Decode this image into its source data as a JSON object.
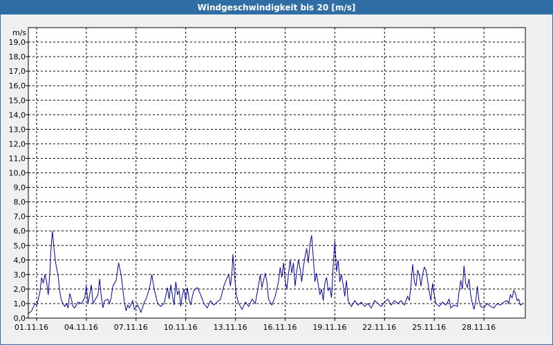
{
  "window": {
    "title": "Windgeschwindigkeit bis 20 [m/s]"
  },
  "colors": {
    "titlebar": "#2f6ea5",
    "line": "#0000a0",
    "grid": "#000000",
    "plot_bg": "#ffffff",
    "window_bg": "#f0f0f0"
  },
  "chart_data": {
    "type": "line",
    "title": "Windgeschwindigkeit bis 20 [m/s]",
    "ylabel": "m/s",
    "xlabel": "",
    "ylim": [
      0,
      20
    ],
    "xlim": [
      0,
      30
    ],
    "grid": true,
    "y_ticks": [
      "0,0",
      "1,0",
      "2,0",
      "3,0",
      "4,0",
      "5,0",
      "6,0",
      "7,0",
      "8,0",
      "9,0",
      "10,0",
      "11,0",
      "12,0",
      "13,0",
      "14,0",
      "15,0",
      "16,0",
      "17,0",
      "18,0",
      "19,0"
    ],
    "x_ticks": [
      {
        "day": 0,
        "label": "01.11.16"
      },
      {
        "day": 3,
        "label": "04.11.16"
      },
      {
        "day": 6,
        "label": "07.11.16"
      },
      {
        "day": 9,
        "label": "10.11.16"
      },
      {
        "day": 12,
        "label": "13.11.16"
      },
      {
        "day": 15,
        "label": "16.11.16"
      },
      {
        "day": 18,
        "label": "19.11.16"
      },
      {
        "day": 21,
        "label": "22.11.16"
      },
      {
        "day": 24,
        "label": "25.11.16"
      },
      {
        "day": 27,
        "label": "28.11.16"
      }
    ],
    "series": [
      {
        "points": [
          [
            0.0,
            0.3
          ],
          [
            0.2,
            0.5
          ],
          [
            0.4,
            1.0
          ],
          [
            0.5,
            0.9
          ],
          [
            0.6,
            1.3
          ],
          [
            0.7,
            1.8
          ],
          [
            0.8,
            2.8
          ],
          [
            0.9,
            2.4
          ],
          [
            1.0,
            3.0
          ],
          [
            1.1,
            2.5
          ],
          [
            1.2,
            1.6
          ],
          [
            1.3,
            3.2
          ],
          [
            1.35,
            4.5
          ],
          [
            1.45,
            6.0
          ],
          [
            1.55,
            4.8
          ],
          [
            1.65,
            3.8
          ],
          [
            1.8,
            2.9
          ],
          [
            1.9,
            1.8
          ],
          [
            2.0,
            1.2
          ],
          [
            2.2,
            0.8
          ],
          [
            2.3,
            1.0
          ],
          [
            2.4,
            0.7
          ],
          [
            2.5,
            1.7
          ],
          [
            2.6,
            1.3
          ],
          [
            2.7,
            0.8
          ],
          [
            2.8,
            0.7
          ],
          [
            3.0,
            1.1
          ],
          [
            3.2,
            1.0
          ],
          [
            3.4,
            1.4
          ],
          [
            3.5,
            2.2
          ],
          [
            3.6,
            1.0
          ],
          [
            3.7,
            1.6
          ],
          [
            3.8,
            2.3
          ],
          [
            3.9,
            1.0
          ],
          [
            4.0,
            1.2
          ],
          [
            4.2,
            1.6
          ],
          [
            4.3,
            2.7
          ],
          [
            4.4,
            1.5
          ],
          [
            4.5,
            0.7
          ],
          [
            4.6,
            1.2
          ],
          [
            4.8,
            1.3
          ],
          [
            4.9,
            1.0
          ],
          [
            5.0,
            1.4
          ],
          [
            5.1,
            2.2
          ],
          [
            5.3,
            2.6
          ],
          [
            5.45,
            3.8
          ],
          [
            5.6,
            3.0
          ],
          [
            5.7,
            2.0
          ],
          [
            5.8,
            1.1
          ],
          [
            5.9,
            0.5
          ],
          [
            6.0,
            0.9
          ],
          [
            6.1,
            0.7
          ],
          [
            6.3,
            1.2
          ],
          [
            6.4,
            0.6
          ],
          [
            6.6,
            0.9
          ],
          [
            6.8,
            0.4
          ],
          [
            7.0,
            1.1
          ],
          [
            7.1,
            1.3
          ],
          [
            7.3,
            2.0
          ],
          [
            7.45,
            3.0
          ],
          [
            7.6,
            2.0
          ],
          [
            7.8,
            1.0
          ],
          [
            8.0,
            0.8
          ],
          [
            8.2,
            1.0
          ],
          [
            8.4,
            2.1
          ],
          [
            8.5,
            1.3
          ],
          [
            8.6,
            2.3
          ],
          [
            8.7,
            1.5
          ],
          [
            8.8,
            0.9
          ],
          [
            8.9,
            2.5
          ],
          [
            9.0,
            1.6
          ],
          [
            9.1,
            1.9
          ],
          [
            9.2,
            0.8
          ],
          [
            9.3,
            1.6
          ],
          [
            9.4,
            2.0
          ],
          [
            9.5,
            1.2
          ],
          [
            9.6,
            2.1
          ],
          [
            9.7,
            1.3
          ],
          [
            9.8,
            0.9
          ],
          [
            9.9,
            1.5
          ],
          [
            10.0,
            1.9
          ],
          [
            10.2,
            2.1
          ],
          [
            10.4,
            1.6
          ],
          [
            10.6,
            1.0
          ],
          [
            10.8,
            0.7
          ],
          [
            11.0,
            1.2
          ],
          [
            11.2,
            0.9
          ],
          [
            11.4,
            1.1
          ],
          [
            11.6,
            1.3
          ],
          [
            11.8,
            2.2
          ],
          [
            12.0,
            2.8
          ],
          [
            12.1,
            3.0
          ],
          [
            12.2,
            2.2
          ],
          [
            12.3,
            3.3
          ],
          [
            12.35,
            4.4
          ],
          [
            12.45,
            2.9
          ],
          [
            12.55,
            1.6
          ],
          [
            12.7,
            1.0
          ],
          [
            12.9,
            0.6
          ],
          [
            13.1,
            1.1
          ],
          [
            13.3,
            0.8
          ],
          [
            13.5,
            1.3
          ],
          [
            13.7,
            1.0
          ],
          [
            13.9,
            2.3
          ],
          [
            14.0,
            3.0
          ],
          [
            14.1,
            2.1
          ],
          [
            14.3,
            3.1
          ],
          [
            14.4,
            2.5
          ],
          [
            14.5,
            1.3
          ],
          [
            14.7,
            0.9
          ],
          [
            14.9,
            1.5
          ],
          [
            15.1,
            2.5
          ],
          [
            15.2,
            3.5
          ],
          [
            15.3,
            2.8
          ],
          [
            15.4,
            3.8
          ],
          [
            15.5,
            2.6
          ],
          [
            15.6,
            2.0
          ],
          [
            15.7,
            3.0
          ],
          [
            15.8,
            4.0
          ],
          [
            15.9,
            3.1
          ],
          [
            16.0,
            3.8
          ],
          [
            16.1,
            2.2
          ],
          [
            16.2,
            3.2
          ],
          [
            16.3,
            4.0
          ],
          [
            16.4,
            3.4
          ],
          [
            16.5,
            2.5
          ],
          [
            16.6,
            3.5
          ],
          [
            16.7,
            4.2
          ],
          [
            16.8,
            4.8
          ],
          [
            16.9,
            3.8
          ],
          [
            17.0,
            5.1
          ],
          [
            17.1,
            5.7
          ],
          [
            17.2,
            4.2
          ],
          [
            17.3,
            2.5
          ],
          [
            17.4,
            3.1
          ],
          [
            17.5,
            2.3
          ],
          [
            17.6,
            1.6
          ],
          [
            17.7,
            2.0
          ],
          [
            17.8,
            1.2
          ],
          [
            17.9,
            2.4
          ],
          [
            18.0,
            2.8
          ],
          [
            18.1,
            1.9
          ],
          [
            18.2,
            2.1
          ],
          [
            18.3,
            1.4
          ],
          [
            18.4,
            3.6
          ],
          [
            18.5,
            5.3
          ],
          [
            18.6,
            3.2
          ],
          [
            18.7,
            4.0
          ],
          [
            18.8,
            2.5
          ],
          [
            18.9,
            3.0
          ],
          [
            19.0,
            2.3
          ],
          [
            19.1,
            1.5
          ],
          [
            19.2,
            2.6
          ],
          [
            19.3,
            1.2
          ],
          [
            19.5,
            0.8
          ],
          [
            19.7,
            1.2
          ],
          [
            19.9,
            0.9
          ],
          [
            20.1,
            1.1
          ],
          [
            20.3,
            0.8
          ],
          [
            20.5,
            1.0
          ],
          [
            20.7,
            0.7
          ],
          [
            20.9,
            1.2
          ],
          [
            21.1,
            1.0
          ],
          [
            21.3,
            0.8
          ],
          [
            21.5,
            1.1
          ],
          [
            21.7,
            1.3
          ],
          [
            21.9,
            0.9
          ],
          [
            22.1,
            1.2
          ],
          [
            22.3,
            1.0
          ],
          [
            22.5,
            1.2
          ],
          [
            22.7,
            0.9
          ],
          [
            22.9,
            1.5
          ],
          [
            23.0,
            1.2
          ],
          [
            23.1,
            2.3
          ],
          [
            23.2,
            3.7
          ],
          [
            23.3,
            2.5
          ],
          [
            23.4,
            2.2
          ],
          [
            23.5,
            3.3
          ],
          [
            23.6,
            3.0
          ],
          [
            23.7,
            2.2
          ],
          [
            23.8,
            3.0
          ],
          [
            23.9,
            3.5
          ],
          [
            24.0,
            3.3
          ],
          [
            24.1,
            2.6
          ],
          [
            24.2,
            1.8
          ],
          [
            24.3,
            1.2
          ],
          [
            24.4,
            2.4
          ],
          [
            24.5,
            1.6
          ],
          [
            24.6,
            1.0
          ],
          [
            24.8,
            0.8
          ],
          [
            25.0,
            1.1
          ],
          [
            25.2,
            0.9
          ],
          [
            25.4,
            1.3
          ],
          [
            25.5,
            0.7
          ],
          [
            25.7,
            0.9
          ],
          [
            25.9,
            0.8
          ],
          [
            26.0,
            1.8
          ],
          [
            26.1,
            2.6
          ],
          [
            26.2,
            2.0
          ],
          [
            26.3,
            3.6
          ],
          [
            26.4,
            2.4
          ],
          [
            26.5,
            2.1
          ],
          [
            26.6,
            2.7
          ],
          [
            26.7,
            1.6
          ],
          [
            26.8,
            1.0
          ],
          [
            26.9,
            0.6
          ],
          [
            27.0,
            1.1
          ],
          [
            27.1,
            2.2
          ],
          [
            27.2,
            1.2
          ],
          [
            27.3,
            0.8
          ],
          [
            27.5,
            0.7
          ],
          [
            27.7,
            1.0
          ],
          [
            27.9,
            0.8
          ],
          [
            28.1,
            0.7
          ],
          [
            28.3,
            1.0
          ],
          [
            28.5,
            0.9
          ],
          [
            28.7,
            1.1
          ],
          [
            28.9,
            1.2
          ],
          [
            29.0,
            1.0
          ],
          [
            29.1,
            1.6
          ],
          [
            29.2,
            1.4
          ],
          [
            29.3,
            1.9
          ],
          [
            29.4,
            1.7
          ],
          [
            29.5,
            1.2
          ],
          [
            29.6,
            1.3
          ],
          [
            29.7,
            0.9
          ],
          [
            29.85,
            1.0
          ]
        ]
      }
    ]
  }
}
